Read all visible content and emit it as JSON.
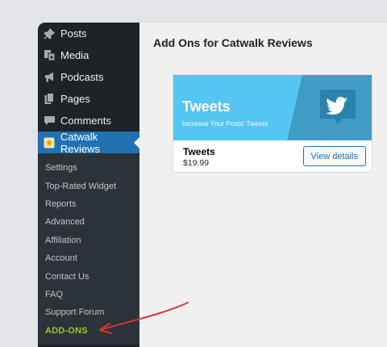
{
  "sidebar": {
    "items": [
      {
        "label": "Posts",
        "icon": "pin-icon"
      },
      {
        "label": "Media",
        "icon": "media-icon"
      },
      {
        "label": "Podcasts",
        "icon": "megaphone-icon"
      },
      {
        "label": "Pages",
        "icon": "pages-icon"
      },
      {
        "label": "Comments",
        "icon": "comment-icon"
      },
      {
        "label": "Catwalk Reviews",
        "icon": "star-icon"
      }
    ],
    "submenu": [
      "Settings",
      "Top-Rated Widget",
      "Reports",
      "Advanced",
      "Affiliation",
      "Account",
      "Contact Us",
      "FAQ",
      "Support Forum",
      "ADD-ONS"
    ]
  },
  "main": {
    "title": "Add Ons for Catwalk Reviews",
    "addon": {
      "banner_title": "Tweets",
      "banner_subtitle": "Increase Your Posts' Tweets",
      "name": "Tweets",
      "price": "$19.99",
      "button_label": "View details",
      "icon": "twitter-bird-icon"
    }
  },
  "colors": {
    "sidebar_bg": "#1d2327",
    "submenu_bg": "#2c3338",
    "current_bg": "#2271b1",
    "active_sub": "#9ec535",
    "banner_light": "#55c6f1",
    "banner_dark": "#3f9cc4",
    "annotation_arrow": "#d63638"
  }
}
